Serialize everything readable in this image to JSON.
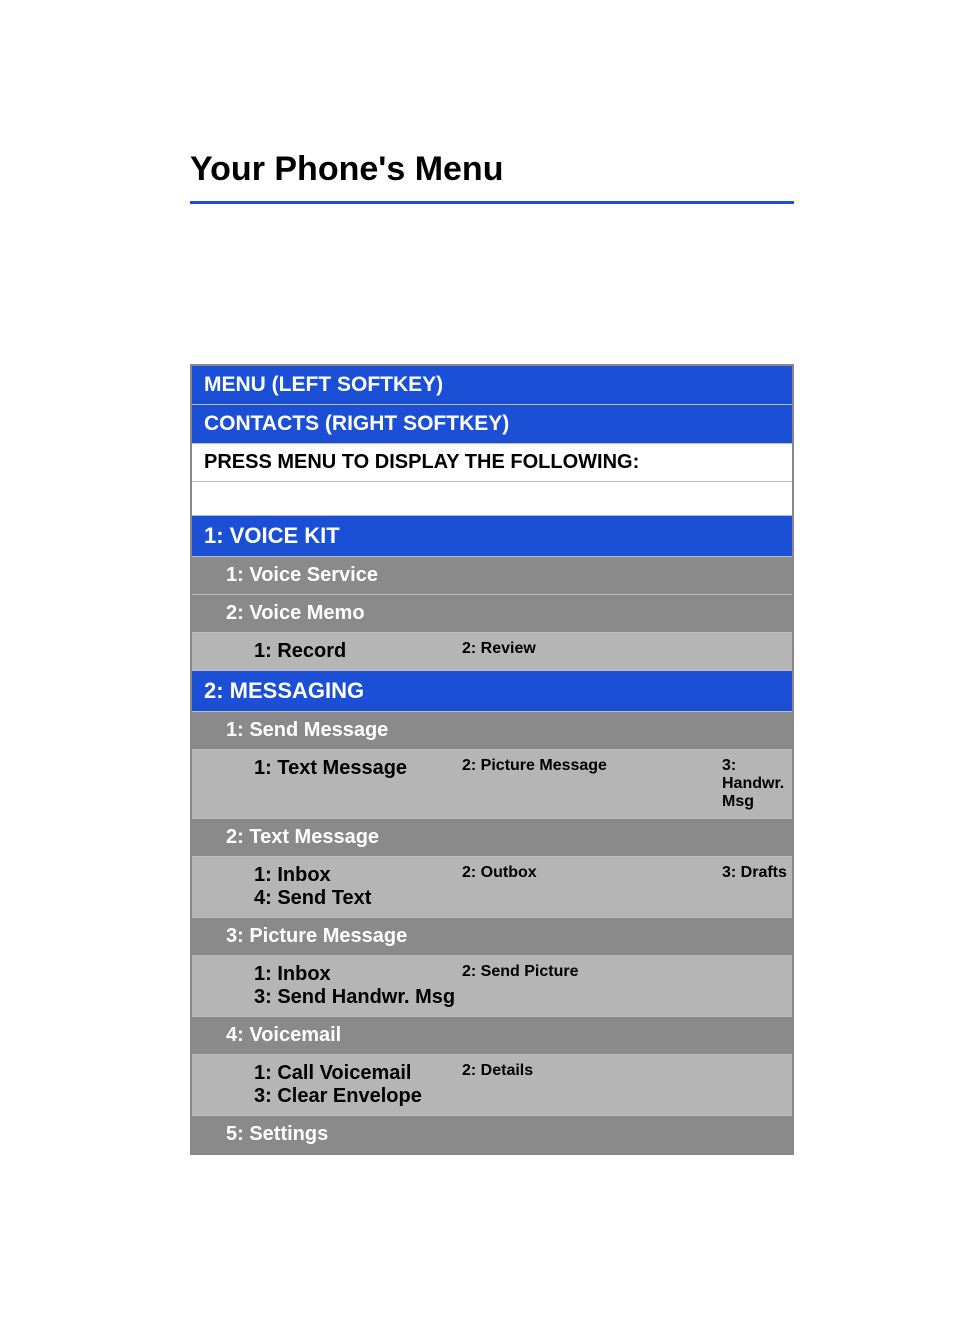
{
  "title": "Your Phone's Menu",
  "header": {
    "menu_softkey": "MENU (LEFT SOFTKEY)",
    "contacts_softkey": "CONTACTS (RIGHT SOFTKEY)",
    "press_menu": "PRESS MENU TO DISPLAY THE FOLLOWING:"
  },
  "sections": {
    "voice_kit": {
      "title": "1: VOICE KIT",
      "voice_service": "1: Voice Service",
      "voice_memo": "2: Voice Memo",
      "voice_memo_sub": {
        "record": "1: Record",
        "review": "2: Review"
      }
    },
    "messaging": {
      "title": "2: MESSAGING",
      "send_message": "1: Send Message",
      "send_message_sub": {
        "text": "1: Text Message",
        "picture": "2: Picture Message",
        "handwr": "3: Handwr. Msg"
      },
      "text_message": "2: Text Message",
      "text_message_sub": {
        "inbox": "1: Inbox",
        "outbox": "2: Outbox",
        "drafts": "3: Drafts",
        "send_text": "4: Send Text"
      },
      "picture_message": "3: Picture Message",
      "picture_message_sub": {
        "inbox": "1: Inbox",
        "send_picture": "2: Send Picture",
        "send_handwr": "3: Send Handwr. Msg"
      },
      "voicemail": "4: Voicemail",
      "voicemail_sub": {
        "call": "1: Call Voicemail",
        "details": "2: Details",
        "clear": "3: Clear Envelope"
      },
      "settings": "5: Settings"
    }
  }
}
